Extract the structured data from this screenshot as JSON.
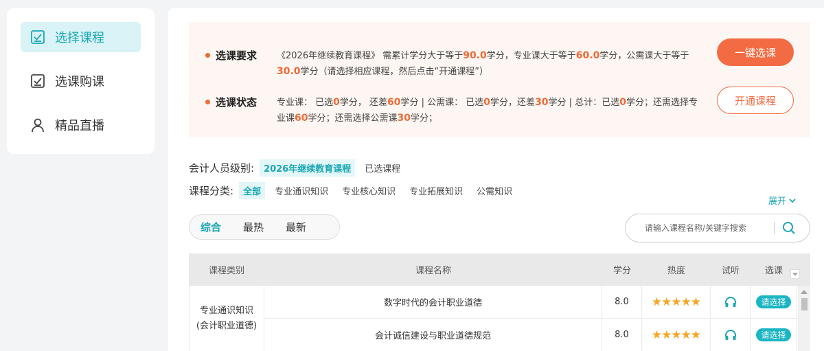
{
  "sidebar": {
    "items": [
      {
        "label": "选择课程",
        "icon": "checkbox-icon",
        "active": true
      },
      {
        "label": "选课购课",
        "icon": "checkbox-icon",
        "active": false
      },
      {
        "label": "精品直播",
        "icon": "user-icon",
        "active": false
      }
    ]
  },
  "notice": {
    "req_title": "选课要求",
    "req": {
      "p1": "《2026年继续教育课程》 需累计学分大于等于",
      "v1": "90.0",
      "p2": "学分，专业课大于等于",
      "v2": "60.0",
      "p3": "学分，公需课大于等于",
      "v3": "30.0",
      "p4": "学分（请选择相应课程，然后点击“开通课程”）"
    },
    "status_title": "选课状态",
    "status": {
      "s1": "专业课：  已选",
      "v1": "0",
      "s2": "学分，  还差",
      "v2": "60",
      "s3": "学分 | 公需课：  已选",
      "v3": "0",
      "s4": "学分，还差",
      "v4": "30",
      "s5": "学分 | 总计：已选",
      "v5": "0",
      "s6": "学分；还需选择专业课",
      "v6": "60",
      "s7": "学分；还需选择公需课",
      "v7": "30",
      "s8": "学分；"
    },
    "btn_one_click": "一键选课",
    "btn_open": "开通课程"
  },
  "filters": {
    "level_label": "会计人员级别:",
    "levels": [
      {
        "label": "2026年继续教育课程",
        "on": true
      },
      {
        "label": "已选课程",
        "on": false
      }
    ],
    "category_label": "课程分类:",
    "categories": [
      {
        "label": "全部",
        "on": true
      },
      {
        "label": "专业通识知识",
        "on": false
      },
      {
        "label": "专业核心知识",
        "on": false
      },
      {
        "label": "专业拓展知识",
        "on": false
      },
      {
        "label": "公需知识",
        "on": false
      }
    ],
    "expand": "展开"
  },
  "sort": {
    "tabs": [
      {
        "label": "综合",
        "on": true
      },
      {
        "label": "最热",
        "on": false
      },
      {
        "label": "最新",
        "on": false
      }
    ]
  },
  "search": {
    "placeholder": "请输入课程名称/关键字搜索"
  },
  "table": {
    "headers": {
      "type": "课程类别",
      "name": "课程名称",
      "score": "学分",
      "heat": "热度",
      "audit": "试听",
      "select": "选课"
    },
    "group": {
      "line1": "专业通识知识",
      "line2": "(会计职业道德)"
    },
    "rows": [
      {
        "name": "数字时代的会计职业道德",
        "score": "8.0",
        "stars": "★★★★★",
        "rating": 5,
        "pick": "请选择"
      },
      {
        "name": "会计诚信建设与职业道德规范",
        "score": "8.0",
        "stars": "★★★★★",
        "rating": 5,
        "pick": "请选择"
      }
    ]
  },
  "colors": {
    "accent": "#1ba7b5",
    "orange": "#f26b42",
    "star": "#f5a623"
  }
}
